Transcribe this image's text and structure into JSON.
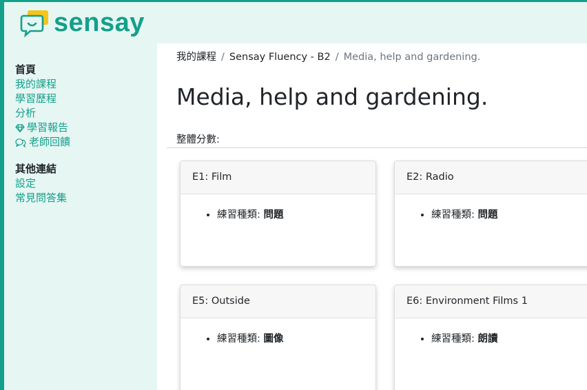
{
  "brand": {
    "name": "sensay",
    "color": "#14a08a",
    "icon": "chat-bubble-smile-icon"
  },
  "sidebar": {
    "section1_heading": "首頁",
    "section1_items": [
      {
        "label": "我的課程"
      },
      {
        "label": "學習歷程"
      },
      {
        "label": "分析"
      },
      {
        "label": "學習報告",
        "icon": "gem-icon"
      },
      {
        "label": "老師回饋",
        "icon": "chat-bubbles-icon"
      }
    ],
    "section2_heading": "其他連結",
    "section2_items": [
      {
        "label": "設定"
      },
      {
        "label": "常見問答集"
      }
    ]
  },
  "breadcrumb": {
    "items": [
      "我的課程",
      "Sensay Fluency - B2",
      "Media, help and gardening."
    ],
    "separator": "/"
  },
  "page": {
    "title": "Media, help and gardening.",
    "score_label": "整體分數:"
  },
  "cards": [
    {
      "title": "E1: Film",
      "type_label": "練習種類:",
      "type_value": "問題"
    },
    {
      "title": "E2: Radio",
      "type_label": "練習種類:",
      "type_value": "問題"
    },
    {
      "title": "E5: Outside",
      "type_label": "練習種類:",
      "type_value": "圖像"
    },
    {
      "title": "E6: Environment Films 1",
      "type_label": "練習種類:",
      "type_value": "朗讀"
    }
  ]
}
